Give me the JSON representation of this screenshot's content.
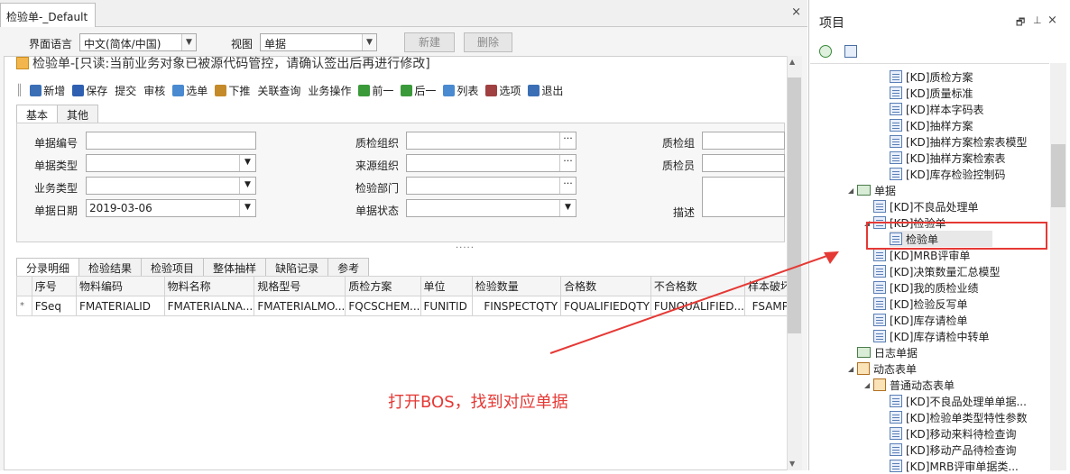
{
  "doc_tab": {
    "title": "检验单-_Default",
    "close": "×"
  },
  "top": {
    "lang_label": "界面语言",
    "lang_value": "中文(简体/中国)",
    "view_label": "视图",
    "view_value": "单据",
    "new_btn": "新建",
    "delete_btn": "删除"
  },
  "form_title": "检验单-[只读:当前业务对象已被源代码管控，请确认签出后再进行修改]",
  "toolbar": [
    {
      "label": "新增",
      "icon": "new-doc-icon",
      "color": "#3b6fb5"
    },
    {
      "label": "保存",
      "icon": "save-icon",
      "color": "#2f5fb0"
    },
    {
      "label": "提交",
      "icon": "",
      "color": ""
    },
    {
      "label": "审核",
      "icon": "",
      "color": ""
    },
    {
      "label": "选单",
      "icon": "select-bill-icon",
      "color": "#4a8ad0"
    },
    {
      "label": "下推",
      "icon": "push-down-icon",
      "color": "#c58a2a"
    },
    {
      "label": "关联查询",
      "icon": "",
      "color": ""
    },
    {
      "label": "业务操作",
      "icon": "",
      "color": ""
    },
    {
      "label": "前一",
      "icon": "arrow-left-icon",
      "color": "#3a9a3a"
    },
    {
      "label": "后一",
      "icon": "arrow-right-icon",
      "color": "#3a9a3a"
    },
    {
      "label": "列表",
      "icon": "list-icon",
      "color": "#4a8ad0"
    },
    {
      "label": "选项",
      "icon": "options-icon",
      "color": "#a04040"
    },
    {
      "label": "退出",
      "icon": "exit-icon",
      "color": "#3b6fb5"
    }
  ],
  "tabs_top": [
    "基本",
    "其他"
  ],
  "fields": {
    "bill_no": "单据编号",
    "bill_type": "单据类型",
    "biz_type": "业务类型",
    "bill_date": "单据日期",
    "bill_date_value": "2019-03-06",
    "qc_org": "质检组织",
    "src_org": "来源组织",
    "insp_dept": "检验部门",
    "bill_status": "单据状态",
    "qc_group": "质检组",
    "inspector": "质检员",
    "desc": "描述"
  },
  "tabs_bottom": [
    "分录明细",
    "检验结果",
    "检验项目",
    "整体抽样",
    "缺陷记录",
    "参考"
  ],
  "grid": {
    "headers": [
      "序号",
      "物料编码",
      "物料名称",
      "规格型号",
      "质检方案",
      "单位",
      "检验数量",
      "合格数",
      "不合格数",
      "样本破坏"
    ],
    "row": [
      "FSeq",
      "FMATERIALID",
      "FMATERIALNA...",
      "FMATERIALMO...",
      "FQCSCHEM...",
      "FUNITID",
      "FINSPECTQTY",
      "FQUALIFIEDQTY",
      "FUNQUALIFIED...",
      "FSAMP"
    ],
    "row_marker": "*"
  },
  "right_panel": {
    "title": "项目",
    "window_controls": [
      "restore-icon",
      "pin-icon",
      "close-icon"
    ],
    "tree": [
      {
        "label": "[KD]质检方案",
        "level": 3,
        "kind": "form"
      },
      {
        "label": "[KD]质量标准",
        "level": 3,
        "kind": "form"
      },
      {
        "label": "[KD]样本字码表",
        "level": 3,
        "kind": "form"
      },
      {
        "label": "[KD]抽样方案",
        "level": 3,
        "kind": "form"
      },
      {
        "label": "[KD]抽样方案检索表模型",
        "level": 3,
        "kind": "form"
      },
      {
        "label": "[KD]抽样方案检索表",
        "level": 3,
        "kind": "form"
      },
      {
        "label": "[KD]库存检验控制码",
        "level": 3,
        "kind": "form"
      },
      {
        "label": "单据",
        "level": 1,
        "kind": "folder",
        "expanded": true
      },
      {
        "label": "[KD]不良品处理单",
        "level": 2,
        "kind": "form"
      },
      {
        "label": "[KD]检验单",
        "level": 2,
        "kind": "form",
        "expanded": true
      },
      {
        "label": "检验单",
        "level": 3,
        "kind": "form",
        "selected": true
      },
      {
        "label": "[KD]MRB评审单",
        "level": 2,
        "kind": "form"
      },
      {
        "label": "[KD]决策数量汇总模型",
        "level": 2,
        "kind": "form"
      },
      {
        "label": "[KD]我的质检业绩",
        "level": 2,
        "kind": "form"
      },
      {
        "label": "[KD]检验反写单",
        "level": 2,
        "kind": "form"
      },
      {
        "label": "[KD]库存请检单",
        "level": 2,
        "kind": "form"
      },
      {
        "label": "[KD]库存请检中转单",
        "level": 2,
        "kind": "form"
      },
      {
        "label": "日志单据",
        "level": 1,
        "kind": "folder"
      },
      {
        "label": "动态表单",
        "level": 1,
        "kind": "dynamic",
        "expanded": true
      },
      {
        "label": "普通动态表单",
        "level": 2,
        "kind": "dynamic",
        "expanded": true
      },
      {
        "label": "[KD]不良品处理单单据...",
        "level": 3,
        "kind": "form"
      },
      {
        "label": "[KD]检验单类型特性参数",
        "level": 3,
        "kind": "form"
      },
      {
        "label": "[KD]移动来料待检查询",
        "level": 3,
        "kind": "form"
      },
      {
        "label": "[KD]移动产品待检查询",
        "level": 3,
        "kind": "form"
      },
      {
        "label": "[KD]MRB评审单据类...",
        "level": 3,
        "kind": "form"
      }
    ]
  },
  "annotation": "打开BOS，找到对应单据",
  "colors": {
    "annotation": "#e53935",
    "highlight_box": "#e53935"
  }
}
